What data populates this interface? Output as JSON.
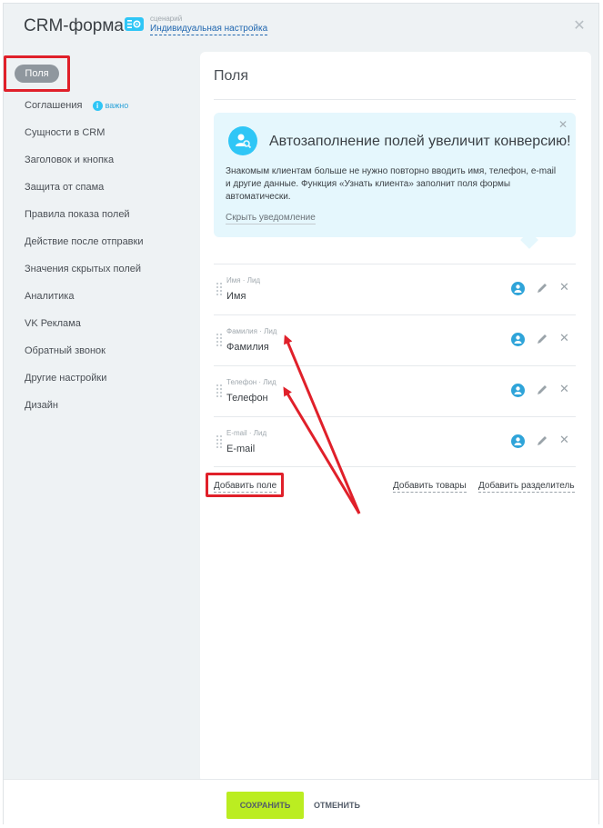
{
  "header": {
    "title": "CRM-форма",
    "scenario_caption": "сценарий",
    "scenario_link": "Индивидуальная настройка",
    "close_icon": "close-icon"
  },
  "sidebar": {
    "active_label": "Поля",
    "items": [
      {
        "label": "Соглашения",
        "badge": "важно"
      },
      {
        "label": "Сущности в CRM"
      },
      {
        "label": "Заголовок и кнопка"
      },
      {
        "label": "Защита от спама"
      },
      {
        "label": "Правила показа полей"
      },
      {
        "label": "Действие после отправки"
      },
      {
        "label": "Значения скрытых полей"
      },
      {
        "label": "Аналитика"
      },
      {
        "label": "VK Реклама"
      },
      {
        "label": "Обратный звонок"
      },
      {
        "label": "Другие настройки"
      },
      {
        "label": "Дизайн"
      }
    ]
  },
  "panel": {
    "title": "Поля",
    "notice": {
      "title": "Автозаполнение полей увеличит конверсию!",
      "text": "Знакомым клиентам больше не нужно повторно вводить имя, телефон, e-mail и другие данные. Функция «Узнать клиента» заполнит поля формы автоматически.",
      "hide_link": "Скрыть уведомление"
    },
    "fields": [
      {
        "caption": "Имя · Лид",
        "label": "Имя"
      },
      {
        "caption": "Фамилия · Лид",
        "label": "Фамилия"
      },
      {
        "caption": "Телефон · Лид",
        "label": "Телефон"
      },
      {
        "caption": "E-mail · Лид",
        "label": "E-mail"
      }
    ],
    "actions": {
      "add_field": "Добавить поле",
      "add_goods": "Добавить товары",
      "add_divider": "Добавить разделитель"
    }
  },
  "footer": {
    "save": "СОХРАНИТЬ",
    "cancel": "ОТМЕНИТЬ"
  },
  "colors": {
    "accent": "#2fc6f6",
    "save_button": "#bbed21",
    "annotation_red": "#e0202a"
  }
}
